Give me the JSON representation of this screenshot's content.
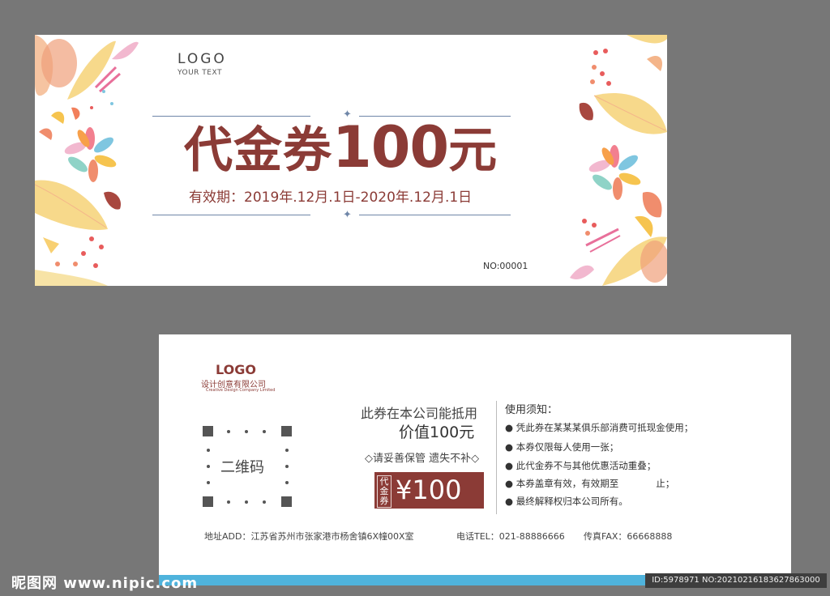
{
  "colors": {
    "brand": "#8b3b36",
    "accent_blue": "#4fb3dc",
    "rule": "#6f86a8"
  },
  "front": {
    "logo": "LOGO",
    "logo_sub": "YOUR TEXT",
    "title_text": "代金券",
    "title_amount": "100",
    "title_unit": "元",
    "validity": "有效期：2019年.12月.1日-2020年.12月.1日",
    "serial": "NO:00001"
  },
  "back": {
    "logo": "LOGO",
    "company": "设计创意有限公司",
    "company_en": "Creative Design Company Limited",
    "qr_label": "二维码",
    "offer_line1": "此券在本公司能抵用",
    "offer_line2": "价值100元",
    "keep_note": "◇请妥善保管 遗失不补◇",
    "stamp_tag": "代金券",
    "stamp_amount": "¥100",
    "notice_title": "使用须知：",
    "notice_items": [
      "● 凭此券在某某某俱乐部消费可抵现金使用；",
      "● 本券仅限每人使用一张；",
      "● 此代金券不与其他优惠活动重叠；",
      "● 本券盖章有效，有效期至　　　　止；",
      "● 最终解释权归本公司所有。"
    ],
    "address": "地址ADD：江苏省苏州市张家港市杨舍镇6X幢00X室",
    "phone": "电话TEL：021-88886666",
    "fax": "传真FAX：66668888"
  },
  "watermark": {
    "site": "昵图网 www.nipic.com",
    "id": "ID:5978971 NO:20210216183627863000"
  }
}
